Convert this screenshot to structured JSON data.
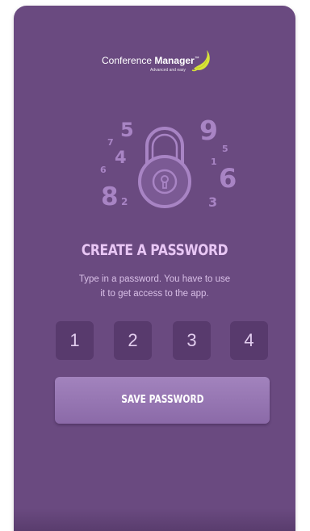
{
  "app": {
    "logo_brand_prefix": "Conference",
    "logo_brand_bold": "Manager",
    "logo_tm": "™",
    "logo_tagline": "Advanced and easy"
  },
  "illustration": {
    "icon": "padlock-icon",
    "numbers_left": [
      "5",
      "7",
      "4",
      "6",
      "8",
      "2"
    ],
    "numbers_right": [
      "9",
      "5",
      "1",
      "6",
      "3"
    ]
  },
  "screen": {
    "title": "CREATE A PASSWORD",
    "description_line1": "Type in a password. You have to use",
    "description_line2": "it to get access to the app."
  },
  "password": {
    "digits": [
      "1",
      "2",
      "3",
      "4"
    ]
  },
  "actions": {
    "save_label": "SAVE PASSWORD"
  },
  "colors": {
    "background": "#6a4a80",
    "accent": "#d7e23a",
    "digit_box": "#583a6d",
    "title": "#e8c6f4"
  }
}
